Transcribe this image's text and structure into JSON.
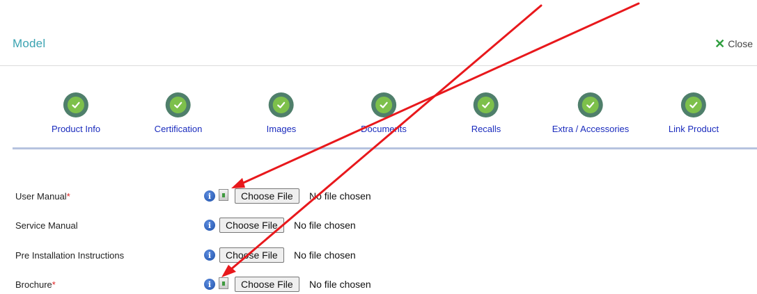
{
  "header": {
    "title": "Model",
    "close_label": "Close"
  },
  "steps": [
    {
      "label": "Product Info"
    },
    {
      "label": "Certification"
    },
    {
      "label": "Images"
    },
    {
      "label": "Documents"
    },
    {
      "label": "Recalls"
    },
    {
      "label": "Extra / Accessories"
    },
    {
      "label": "Link Product"
    }
  ],
  "form": {
    "rows": [
      {
        "label": "User Manual",
        "required_mark": "*",
        "button": "Choose File",
        "status": "No file chosen"
      },
      {
        "label": "Service Manual",
        "required_mark": "",
        "button": "Choose File",
        "status": "No file chosen"
      },
      {
        "label": "Pre Installation Instructions",
        "required_mark": "",
        "button": "Choose File",
        "status": "No file chosen"
      },
      {
        "label": "Brochure",
        "required_mark": "*",
        "button": "Choose File",
        "status": "No file chosen"
      }
    ]
  },
  "icons": {
    "step": "check-circle-icon",
    "info": "info-icon",
    "download": "download-icon",
    "close": "close-x-icon"
  },
  "colors": {
    "title": "#3aa3b1",
    "step_label": "#1a2bbd",
    "check_outer": "#4f7f6b",
    "check_inner": "#7dc04b",
    "close_x": "#2e9e3e",
    "required": "#e02020",
    "annotation_arrow": "#e8181c"
  }
}
